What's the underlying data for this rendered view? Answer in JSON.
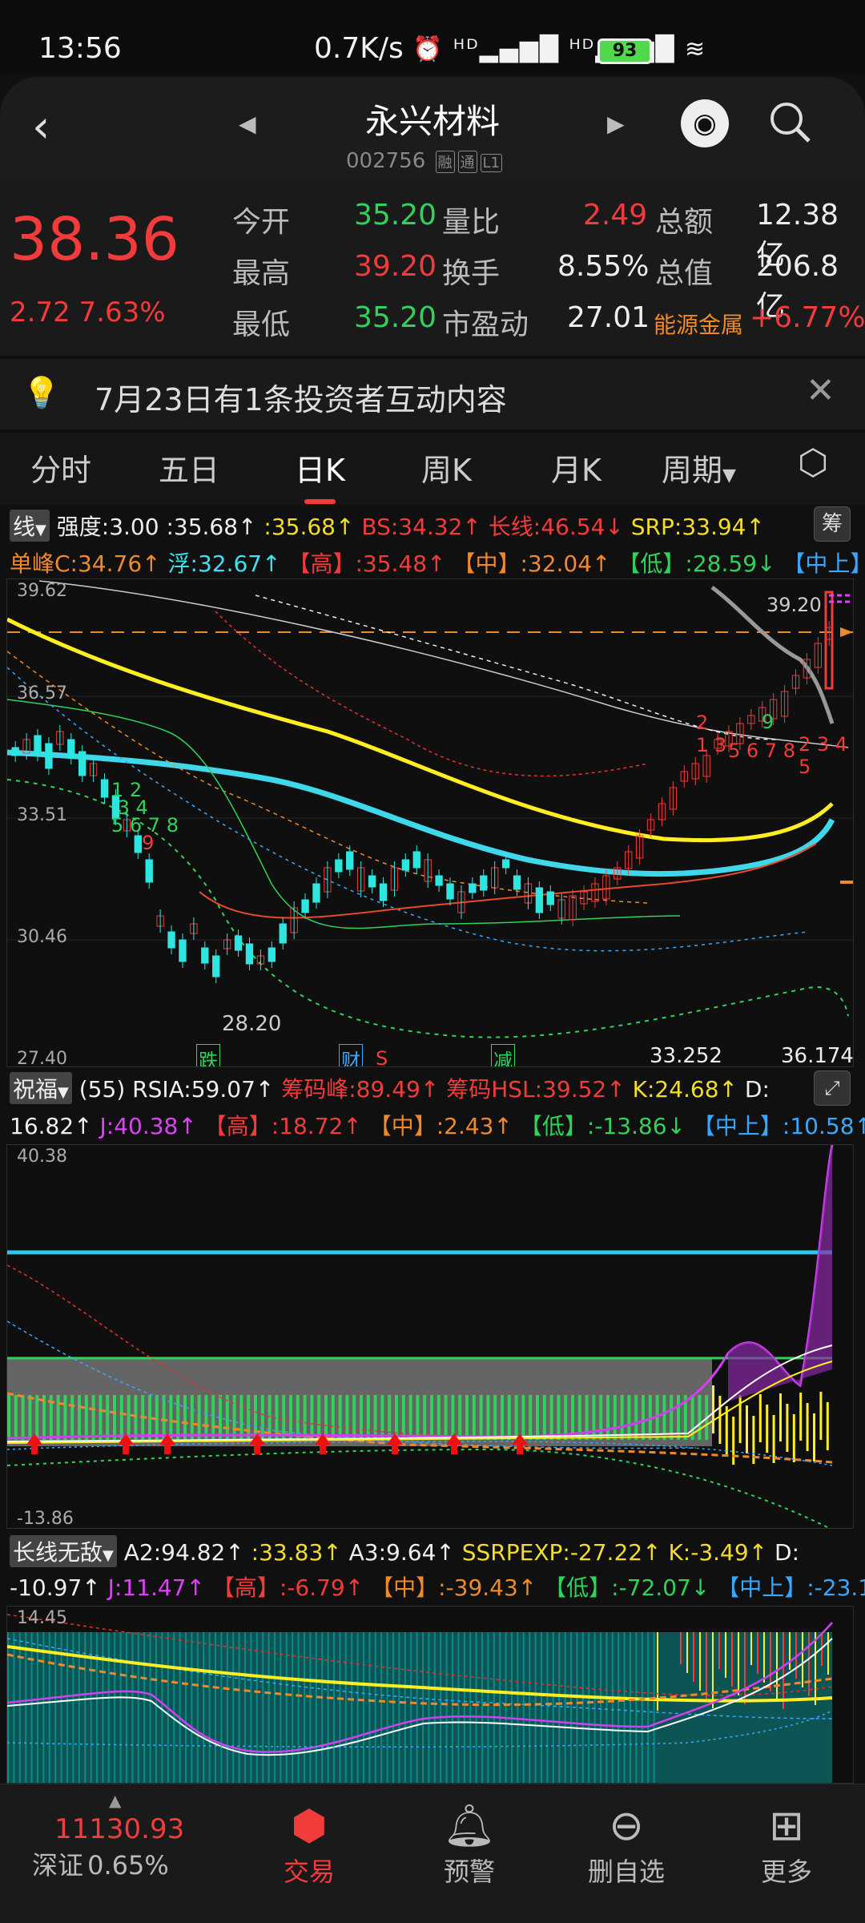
{
  "status": {
    "time": "13:56",
    "net": "0.7K/s",
    "icons": "⏰ ᴴᴰ▂▄▆█ ᴴᴰ▂▄▆█ ≋",
    "battery": "93"
  },
  "header": {
    "title": "永兴材料",
    "code": "002756",
    "tag1": "融",
    "tag2": "通",
    "tag3": "L1"
  },
  "quote": {
    "price": "38.36",
    "change": "2.72  7.63%",
    "rows": [
      {
        "l1": "今开",
        "v1": "35.20",
        "l2": "量比",
        "v2": "2.49",
        "l3": "总额",
        "v3": "12.38亿"
      },
      {
        "l1": "最高",
        "v1": "39.20",
        "l2": "换手",
        "v2": "8.55%",
        "l3": "总值",
        "v3": "206.8亿"
      },
      {
        "l1": "最低",
        "v1": "35.20",
        "l2": "市盈动",
        "v2": "27.01",
        "l3": "能源金属",
        "v3": "+6.77%"
      }
    ]
  },
  "notice": {
    "text": "7月23日有1条投资者互动内容"
  },
  "tabs": [
    "分时",
    "五日",
    "日K",
    "周K",
    "月K",
    "周期"
  ],
  "kline": {
    "ind": "线",
    "line1": [
      {
        "t": "强度:3.00",
        "c": "white"
      },
      {
        "t": " :35.68↑",
        "c": "white"
      },
      {
        "t": " :35.68↑",
        "c": "yellow"
      },
      {
        "t": " BS:34.32↑",
        "c": "red"
      },
      {
        "t": " 长线:46.54↓",
        "c": "red"
      },
      {
        "t": " SRP:33.94↑",
        "c": "yellow"
      }
    ],
    "line2": [
      {
        "t": "单峰C:34.76↑",
        "c": "orange"
      },
      {
        "t": " 浮:32.67↑",
        "c": "cyan"
      },
      {
        "t": " 【高】:35.48↑",
        "c": "red"
      },
      {
        "t": " 【中】:32.04↑",
        "c": "orange"
      },
      {
        "t": " 【低】:28.59↓",
        "c": "green"
      },
      {
        "t": " 【中上】:",
        "c": "blue"
      }
    ],
    "chip": "筹",
    "ylabels": [
      "39.62",
      "36.57",
      "33.51",
      "30.46",
      "27.40"
    ],
    "high_label": "39.20",
    "low_label": "28.20",
    "bottom_vals": [
      "33.252",
      "36.174"
    ],
    "events": [
      "跌",
      "财",
      "S",
      "减"
    ],
    "nums": [
      "9",
      "5",
      "6",
      "8",
      "2",
      "1",
      "3",
      "4",
      "1",
      "2",
      "3",
      "5",
      "6",
      "7",
      "8",
      "9"
    ]
  },
  "ind2": {
    "name": "祝福",
    "line1": [
      {
        "t": " (55) RSIA:59.07↑",
        "c": "white"
      },
      {
        "t": " 筹码峰:89.49↑",
        "c": "red"
      },
      {
        "t": " 筹码HSL:39.52↑",
        "c": "red"
      },
      {
        "t": " K:24.68↑",
        "c": "yellow"
      },
      {
        "t": " D:",
        "c": "white"
      }
    ],
    "line2": [
      {
        "t": "16.82↑",
        "c": "white"
      },
      {
        "t": " J:40.38↑",
        "c": "magenta"
      },
      {
        "t": " 【高】:18.72↑",
        "c": "red"
      },
      {
        "t": " 【中】:2.43↑",
        "c": "orange"
      },
      {
        "t": " 【低】:-13.86↓",
        "c": "green"
      },
      {
        "t": " 【中上】:10.58↑",
        "c": "blue"
      }
    ],
    "ymax": "40.38",
    "ymin": "-13.86"
  },
  "ind3": {
    "name": "长线无敌",
    "line1": [
      {
        "t": " A2:94.82↑",
        "c": "white"
      },
      {
        "t": " :33.83↑",
        "c": "yellow"
      },
      {
        "t": " A3:9.64↑",
        "c": "white"
      },
      {
        "t": " SSRPEXP:-27.22↑",
        "c": "yellow"
      },
      {
        "t": " K:-3.49↑",
        "c": "yellow"
      },
      {
        "t": " D:",
        "c": "white"
      }
    ],
    "line2": [
      {
        "t": "-10.97↑",
        "c": "white"
      },
      {
        "t": " J:11.47↑",
        "c": "magenta"
      },
      {
        "t": " 【高】:-6.79↑",
        "c": "red"
      },
      {
        "t": " 【中】:-39.43↑",
        "c": "orange"
      },
      {
        "t": " 【低】:-72.07↓",
        "c": "green"
      },
      {
        "t": " 【中上】:-23.1",
        "c": "blue"
      }
    ],
    "ymax": "14.45"
  },
  "nav": {
    "index_value": "11130.93",
    "index_name": "深证",
    "index_pct": "0.65%",
    "items": [
      "交易",
      "预警",
      "删自选",
      "更多"
    ]
  }
}
